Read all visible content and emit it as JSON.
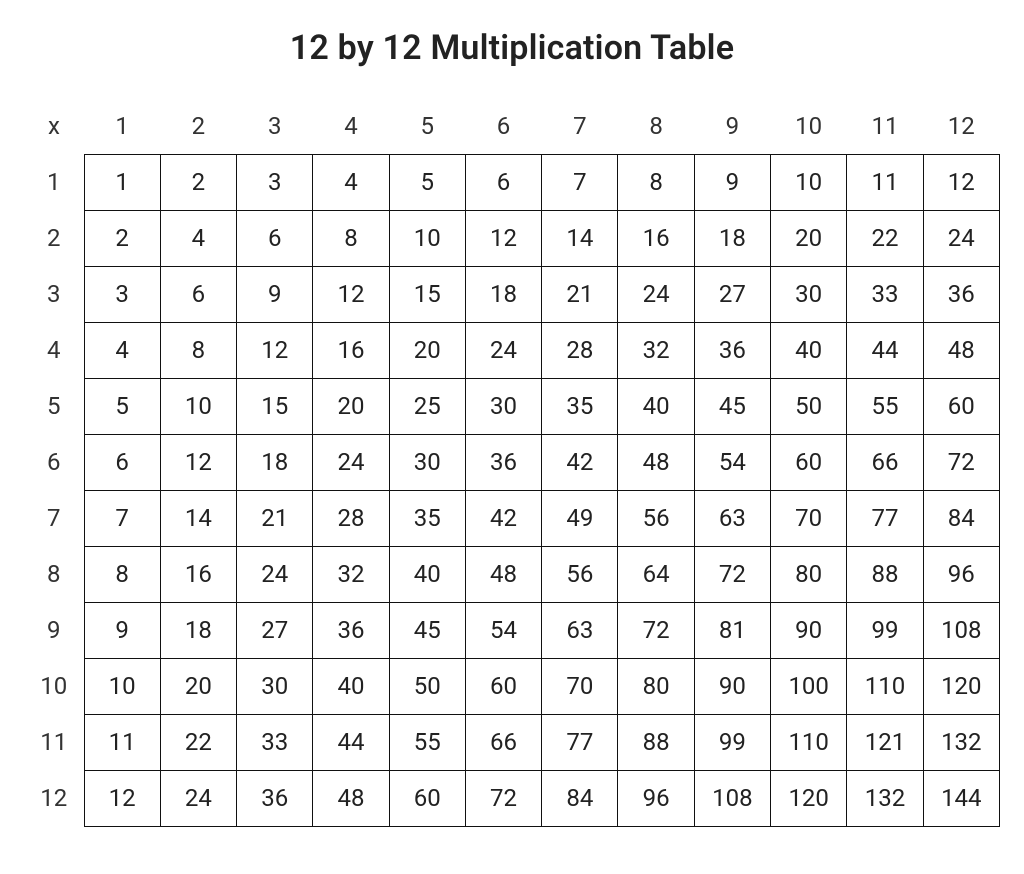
{
  "title": "12 by 12 Multiplication Table",
  "corner_label": "x",
  "col_headers": [
    "1",
    "2",
    "3",
    "4",
    "5",
    "6",
    "7",
    "8",
    "9",
    "10",
    "11",
    "12"
  ],
  "row_headers": [
    "1",
    "2",
    "3",
    "4",
    "5",
    "6",
    "7",
    "8",
    "9",
    "10",
    "11",
    "12"
  ],
  "rows": [
    [
      "1",
      "2",
      "3",
      "4",
      "5",
      "6",
      "7",
      "8",
      "9",
      "10",
      "11",
      "12"
    ],
    [
      "2",
      "4",
      "6",
      "8",
      "10",
      "12",
      "14",
      "16",
      "18",
      "20",
      "22",
      "24"
    ],
    [
      "3",
      "6",
      "9",
      "12",
      "15",
      "18",
      "21",
      "24",
      "27",
      "30",
      "33",
      "36"
    ],
    [
      "4",
      "8",
      "12",
      "16",
      "20",
      "24",
      "28",
      "32",
      "36",
      "40",
      "44",
      "48"
    ],
    [
      "5",
      "10",
      "15",
      "20",
      "25",
      "30",
      "35",
      "40",
      "45",
      "50",
      "55",
      "60"
    ],
    [
      "6",
      "12",
      "18",
      "24",
      "30",
      "36",
      "42",
      "48",
      "54",
      "60",
      "66",
      "72"
    ],
    [
      "7",
      "14",
      "21",
      "28",
      "35",
      "42",
      "49",
      "56",
      "63",
      "70",
      "77",
      "84"
    ],
    [
      "8",
      "16",
      "24",
      "32",
      "40",
      "48",
      "56",
      "64",
      "72",
      "80",
      "88",
      "96"
    ],
    [
      "9",
      "18",
      "27",
      "36",
      "45",
      "54",
      "63",
      "72",
      "81",
      "90",
      "99",
      "108"
    ],
    [
      "10",
      "20",
      "30",
      "40",
      "50",
      "60",
      "70",
      "80",
      "90",
      "100",
      "110",
      "120"
    ],
    [
      "11",
      "22",
      "33",
      "44",
      "55",
      "66",
      "77",
      "88",
      "99",
      "110",
      "121",
      "132"
    ],
    [
      "12",
      "24",
      "36",
      "48",
      "60",
      "72",
      "84",
      "96",
      "108",
      "120",
      "132",
      "144"
    ]
  ],
  "chart_data": {
    "type": "table",
    "title": "12 by 12 Multiplication Table",
    "columns": [
      1,
      2,
      3,
      4,
      5,
      6,
      7,
      8,
      9,
      10,
      11,
      12
    ],
    "rows_index": [
      1,
      2,
      3,
      4,
      5,
      6,
      7,
      8,
      9,
      10,
      11,
      12
    ],
    "values": [
      [
        1,
        2,
        3,
        4,
        5,
        6,
        7,
        8,
        9,
        10,
        11,
        12
      ],
      [
        2,
        4,
        6,
        8,
        10,
        12,
        14,
        16,
        18,
        20,
        22,
        24
      ],
      [
        3,
        6,
        9,
        12,
        15,
        18,
        21,
        24,
        27,
        30,
        33,
        36
      ],
      [
        4,
        8,
        12,
        16,
        20,
        24,
        28,
        32,
        36,
        40,
        44,
        48
      ],
      [
        5,
        10,
        15,
        20,
        25,
        30,
        35,
        40,
        45,
        50,
        55,
        60
      ],
      [
        6,
        12,
        18,
        24,
        30,
        36,
        42,
        48,
        54,
        60,
        66,
        72
      ],
      [
        7,
        14,
        21,
        28,
        35,
        42,
        49,
        56,
        63,
        70,
        77,
        84
      ],
      [
        8,
        16,
        24,
        32,
        40,
        48,
        56,
        64,
        72,
        80,
        88,
        96
      ],
      [
        9,
        18,
        27,
        36,
        45,
        54,
        63,
        72,
        81,
        90,
        99,
        108
      ],
      [
        10,
        20,
        30,
        40,
        50,
        60,
        70,
        80,
        90,
        100,
        110,
        120
      ],
      [
        11,
        22,
        33,
        44,
        55,
        66,
        77,
        88,
        99,
        110,
        121,
        132
      ],
      [
        12,
        24,
        36,
        48,
        60,
        72,
        84,
        96,
        108,
        120,
        132,
        144
      ]
    ]
  }
}
